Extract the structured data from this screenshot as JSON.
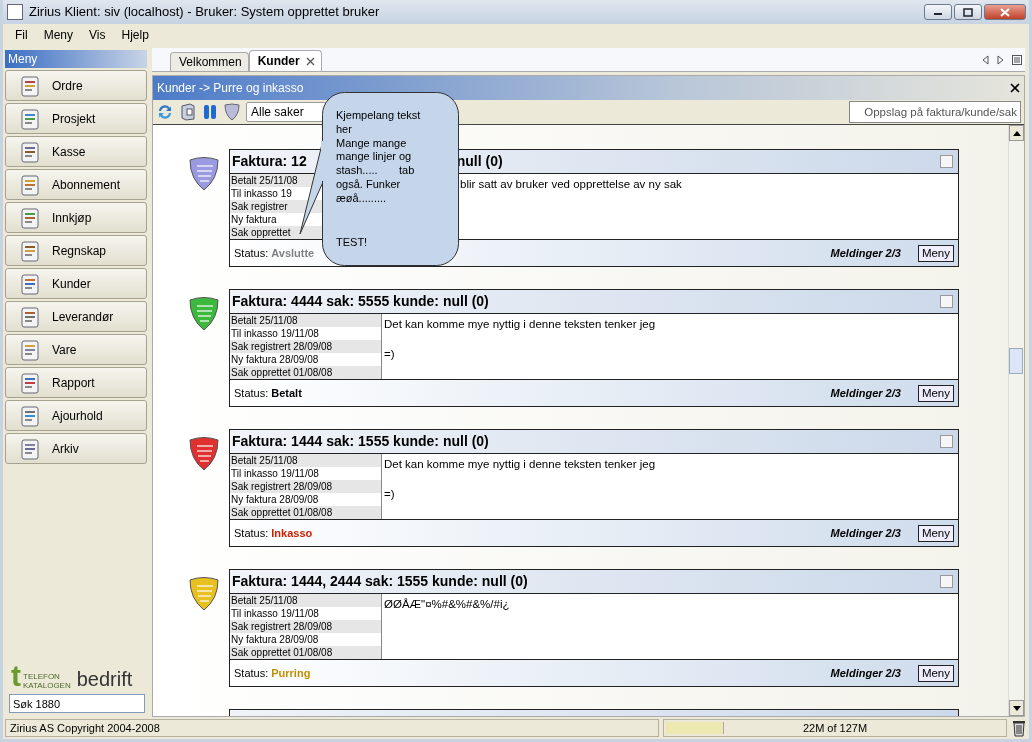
{
  "window": {
    "title": "Zirius  Klient: siv (localhost)  - Bruker: System opprettet bruker"
  },
  "menu_bar": [
    {
      "label": "Fil"
    },
    {
      "label": "Meny"
    },
    {
      "label": "Vis"
    },
    {
      "label": "Hjelp"
    }
  ],
  "sidebar": {
    "title": "Meny",
    "items": [
      {
        "label": "Ordre"
      },
      {
        "label": "Prosjekt"
      },
      {
        "label": "Kasse"
      },
      {
        "label": "Abonnement"
      },
      {
        "label": "Innkjøp"
      },
      {
        "label": "Regnskap"
      },
      {
        "label": "Kunder"
      },
      {
        "label": "Leverandør"
      },
      {
        "label": "Vare"
      },
      {
        "label": "Rapport"
      },
      {
        "label": "Ajourhold"
      },
      {
        "label": "Arkiv"
      }
    ],
    "logo": {
      "mark": "t",
      "top": "TELEFON",
      "bottom": "KATALOGEN",
      "word": "bedrift"
    },
    "search": {
      "value": "Søk 1880"
    }
  },
  "tabs": [
    {
      "label": "Velkommen",
      "selected": false,
      "closable": false
    },
    {
      "label": "Kunder",
      "selected": true,
      "closable": true
    }
  ],
  "panel": {
    "title": "Kunder -> Purre og inkasso",
    "filter": {
      "value": "Alle saker"
    },
    "lookup": {
      "placeholder": "Oppslag på faktura/kunde/sak"
    }
  },
  "tooltip": {
    "lines": [
      "Kjempelang tekst",
      "her",
      "Mange mange",
      "mange linjer og",
      "stash.....       tab",
      "også. Funker",
      "æøå........."
    ],
    "footer": "TEST!"
  },
  "cards": [
    {
      "title": "Faktura: 12",
      "title_tail": "null (0)",
      "covered": true,
      "color": "#9a9ae0",
      "checked": false,
      "events": [
        "Betalt 25/11/08",
        "Til inkasso 19",
        "Sak registrer",
        "Ny faktura",
        "Sak opprettet"
      ],
      "description": [
        "blir satt av bruker ved opprettelse av ny sak"
      ],
      "status_label": "Status:",
      "status": "Avslutte",
      "kind": "closed",
      "messages": "Meldinger 2/3",
      "menu_button": "Meny"
    },
    {
      "title": "Faktura: 4444 sak: 5555 kunde: null (0)",
      "covered": false,
      "color": "#3cb83c",
      "checked": false,
      "events": [
        "Betalt 25/11/08",
        "Til inkasso 19/11/08",
        "Sak registrert 28/09/08",
        "Ny faktura 28/09/08",
        "Sak opprettet 01/08/08"
      ],
      "description": [
        "Det kan komme mye nyttig i denne teksten tenker jeg",
        "=)"
      ],
      "status_label": "Status:",
      "status": "Betalt",
      "kind": "paid",
      "messages": "Meldinger 2/3",
      "menu_button": "Meny"
    },
    {
      "title": "Faktura: 1444 sak: 1555 kunde: null (0)",
      "covered": false,
      "color": "#e03030",
      "checked": false,
      "events": [
        "Betalt 25/11/08",
        "Til inkasso 19/11/08",
        "Sak registrert 28/09/08",
        "Ny faktura 28/09/08",
        "Sak opprettet 01/08/08"
      ],
      "description": [
        "Det kan komme mye nyttig i denne teksten tenker jeg",
        "=)"
      ],
      "status_label": "Status:",
      "status": "Inkasso",
      "kind": "collection",
      "messages": "Meldinger 2/3",
      "menu_button": "Meny"
    },
    {
      "title": "Faktura: 1444, 2444 sak: 1555 kunde: null (0)",
      "covered": false,
      "color": "#e8c020",
      "checked": false,
      "events": [
        "Betalt 25/11/08",
        "Til inkasso 19/11/08",
        "Sak registrert 28/09/08",
        "Ny faktura 28/09/08",
        "Sak opprettet 01/08/08"
      ],
      "description": [
        "ØØÅÆ\"¤%#&%#&%/#i¿"
      ],
      "status_label": "Status:",
      "status": "Purring",
      "kind": "reminder",
      "messages": "Meldinger 2/3",
      "menu_button": "Meny"
    }
  ],
  "status_bar": {
    "copyright": "Zirius AS Copyright 2004-2008",
    "memory": "22M of 127M",
    "level": 0.17
  }
}
